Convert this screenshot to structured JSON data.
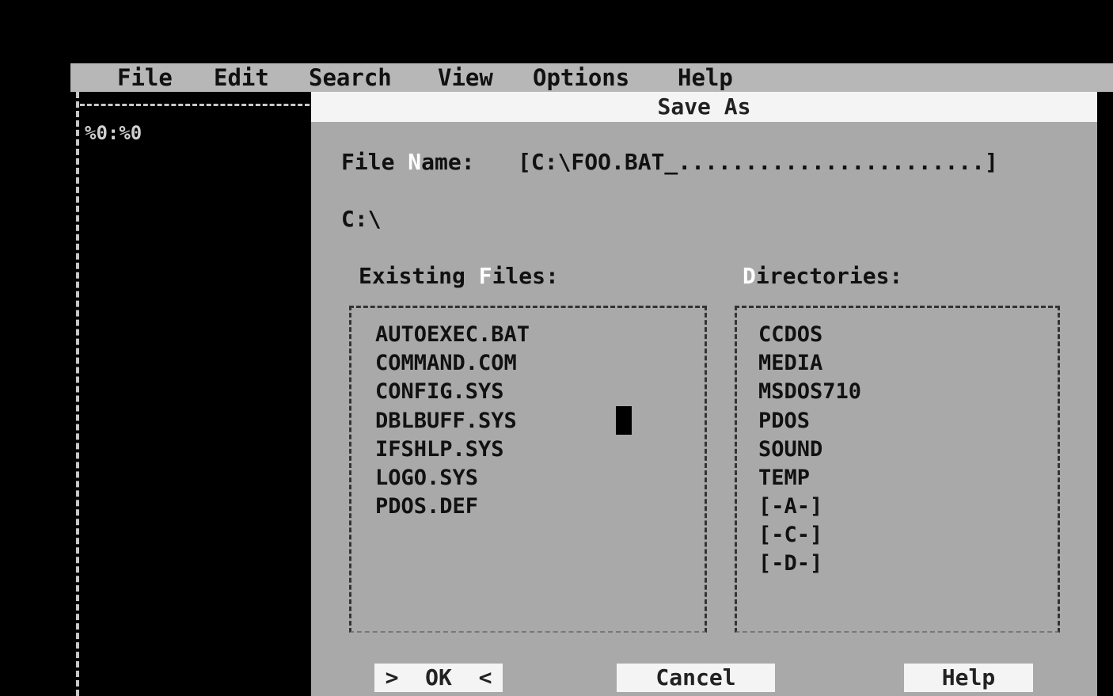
{
  "menu": {
    "items": [
      "File",
      "Edit",
      "Search",
      "View",
      "Options",
      "Help"
    ]
  },
  "editor": {
    "position": "%0:%0"
  },
  "dialog": {
    "title": "Save As",
    "filename_label_pre": "File ",
    "filename_label_hot": "N",
    "filename_label_post": "ame:",
    "filename_value": "[C:\\FOO.BAT_.......................]",
    "current_dir": "C:\\",
    "files_label_pre": "Existing ",
    "files_label_hot": "F",
    "files_label_post": "iles:",
    "dirs_label_hot": "D",
    "dirs_label_post": "irectories:",
    "files": [
      "AUTOEXEC.BAT",
      "COMMAND.COM",
      "CONFIG.SYS",
      "DBLBUFF.SYS",
      "IFSHLP.SYS",
      "LOGO.SYS",
      "PDOS.DEF"
    ],
    "directories": [
      "CCDOS",
      "MEDIA",
      "MSDOS710",
      "PDOS",
      "SOUND",
      "TEMP",
      "[-A-]",
      "[-C-]",
      "[-D-]"
    ],
    "buttons": {
      "ok": ">  OK  <",
      "cancel": "Cancel",
      "help": "Help"
    }
  },
  "colors": {
    "menubar": "#b7b7b7",
    "dialog": "#a9a9a9",
    "title_bar": "#f4f4f4",
    "background": "#000000"
  }
}
